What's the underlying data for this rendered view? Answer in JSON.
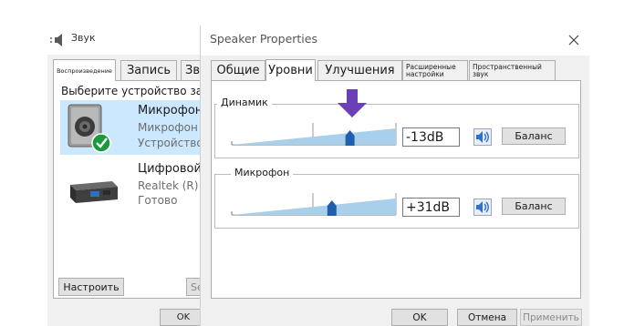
{
  "sound_window": {
    "title": "Звук",
    "tabs": [
      {
        "label": "Воспроизведение",
        "active": true
      },
      {
        "label": "Запись",
        "active": false
      },
      {
        "label": "Зв",
        "active": false
      }
    ],
    "instruction": "Выберите устройство зап",
    "devices": [
      {
        "name": "Микрофон",
        "driver": "Микрофон",
        "status": "Устройство",
        "selected": true,
        "icon": "speaker-default-icon"
      },
      {
        "name": "Цифровой",
        "driver": "Realtek (R)",
        "status": "Готово",
        "selected": false,
        "icon": "digital-output-icon"
      }
    ],
    "configure_label": "Настроить",
    "set_default_label": "Se",
    "ok_label": "OK"
  },
  "props_window": {
    "title": "Speaker Properties",
    "tabs": [
      {
        "label": "Общие",
        "active": false
      },
      {
        "label": "Уровни",
        "active": true
      },
      {
        "label": "Улучшения",
        "active": false
      },
      {
        "label": "Расширенные настройки",
        "active": false
      },
      {
        "label": "Пространственный звук",
        "active": false
      }
    ],
    "groups": {
      "speaker": {
        "label": "Динамик",
        "value": "-13dB",
        "level": 0.72,
        "balance_label": "Баланс"
      },
      "mic": {
        "label": "Микрофон",
        "value": "+31dB",
        "level": 0.61,
        "balance_label": "Баланс"
      }
    },
    "buttons": {
      "ok": "OK",
      "cancel": "Отмена",
      "apply": "Применить"
    }
  },
  "colors": {
    "slider_track": "#a8d0ea",
    "thumb": "#1f5fae",
    "cursor": "#6b3fb5",
    "selection": "#cce8ff",
    "speaker_icon": "#2f6fd0"
  }
}
